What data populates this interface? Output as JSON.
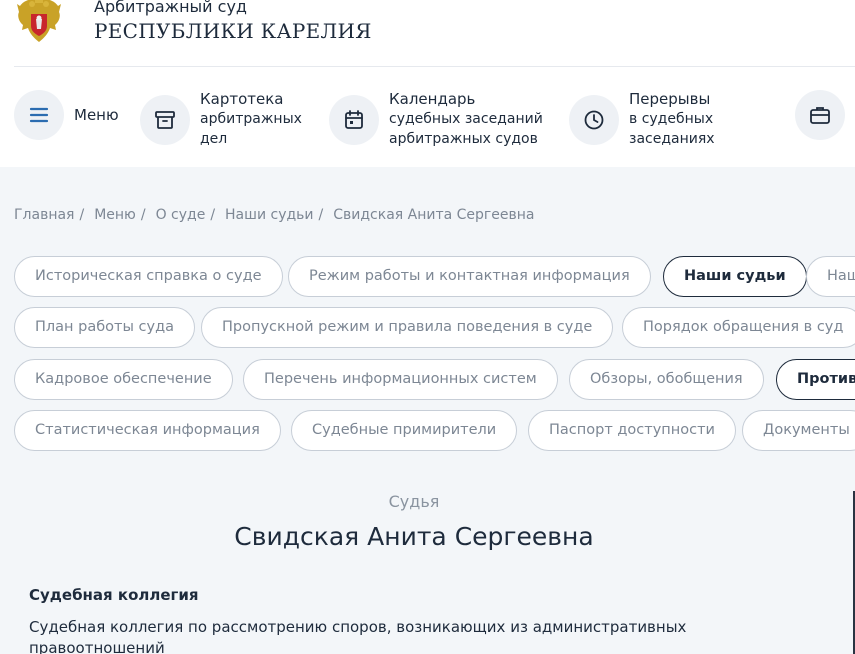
{
  "header": {
    "line1": "Арбитражный суд",
    "line2": "РЕСПУБЛИКИ КАРЕЛИЯ"
  },
  "nav": {
    "menu": "Меню",
    "card": {
      "line1": "Картотека",
      "line2": "арбитражных",
      "line3": "дел"
    },
    "calendar": {
      "line1": "Календарь",
      "line2": "судебных заседаний",
      "line3": "арбитражных судов"
    },
    "breaks": {
      "line1": "Перерывы",
      "line2": "в судебных",
      "line3": "заседаниях"
    }
  },
  "breadcrumb": [
    "Главная",
    "Меню",
    "О суде",
    "Наши судьи",
    "Свидская Анита Сергеевна"
  ],
  "breadcrumb_sep": "/",
  "pills": {
    "row1": [
      "Историческая справка о суде",
      "Режим работы и контактная информация",
      "Наши судьи",
      "Наш"
    ],
    "row2": [
      "План работы суда",
      "Пропускной режим и правила поведения в суде",
      "Порядок обращения в суд"
    ],
    "row3": [
      "Кадровое обеспечение",
      "Перечень информационных систем",
      "Обзоры, обобщения",
      "Противо"
    ],
    "row4": [
      "Статистическая информация",
      "Судебные примирители",
      "Паспорт доступности",
      "Документы"
    ]
  },
  "judge": {
    "role": "Судья",
    "name": "Свидская Анита Сергеевна",
    "collegium_title": "Судебная коллегия",
    "collegium_text": "Судебная коллегия по рассмотрению споров, возникающих из административных правоотношений"
  },
  "colors": {
    "text": "#1e2b3c",
    "muted": "#7d8794",
    "bg": "#f3f6f9",
    "circle": "#eef1f5"
  }
}
